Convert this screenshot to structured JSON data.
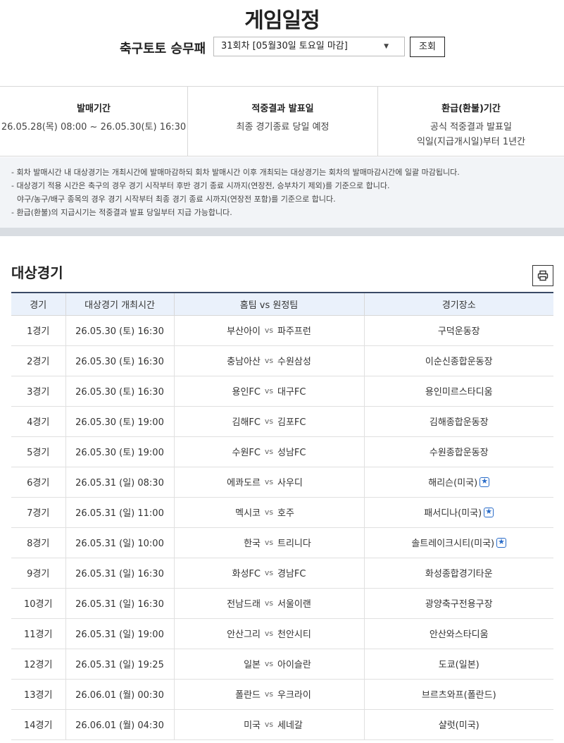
{
  "page_title": "게임일정",
  "filter": {
    "label": "축구토토 승무패",
    "selected_round": "31회차 [05월30일 토요일 마감]",
    "search_button": "조회"
  },
  "info": {
    "sale_period": {
      "title": "발매기간",
      "value": "26.05.28(목) 08:00 ~ 26.05.30(토) 16:30"
    },
    "result_date": {
      "title": "적중결과 발표일",
      "value": "최종 경기종료 당일 예정"
    },
    "refund_period": {
      "title": "환급(환불)기간",
      "line1": "공식 적중결과 발표일",
      "line2": "익일(지급개시일)부터 1년간"
    }
  },
  "notes": [
    "- 회차 발매시간 내 대상경기는 개최시간에 발매마감하되 회차 발매시간 이후 개최되는 대상경기는 회차의 발매마감시간에 일괄 마감됩니다.",
    "- 대상경기 적용 시간은 축구의 경우 경기 시작부터 후반 경기 종료 시까지(연장전, 승부차기 제외)를 기준으로 합니다.",
    "야구/농구/배구 종목의 경우 경기 시작부터 최종 경기 종료 시까지(연장전 포함)를 기준으로 합니다.",
    "- 환급(환불)의 지급시기는 적중결과 발표 당일부터 지급 가능합니다."
  ],
  "section_title": "대상경기",
  "print_icon": "printer-icon",
  "table": {
    "headers": {
      "game": "경기",
      "time": "대상경기 개최시간",
      "teams": "홈팀 vs 원정팀",
      "venue": "경기장소"
    },
    "vs_label": "vs",
    "rows": [
      {
        "game": "1경기",
        "time": "26.05.30 (토) 16:30",
        "home": "부산아이",
        "away": "파주프런",
        "venue": "구덕운동장",
        "star": false
      },
      {
        "game": "2경기",
        "time": "26.05.30 (토) 16:30",
        "home": "충남아산",
        "away": "수원삼성",
        "venue": "이순신종합운동장",
        "star": false
      },
      {
        "game": "3경기",
        "time": "26.05.30 (토) 16:30",
        "home": "용인FC",
        "away": "대구FC",
        "venue": "용인미르스타디움",
        "star": false
      },
      {
        "game": "4경기",
        "time": "26.05.30 (토) 19:00",
        "home": "김해FC",
        "away": "김포FC",
        "venue": "김해종합운동장",
        "star": false
      },
      {
        "game": "5경기",
        "time": "26.05.30 (토) 19:00",
        "home": "수원FC",
        "away": "성남FC",
        "venue": "수원종합운동장",
        "star": false
      },
      {
        "game": "6경기",
        "time": "26.05.31 (일) 08:30",
        "home": "에콰도르",
        "away": "사우디",
        "venue": "해리슨(미국)",
        "star": true
      },
      {
        "game": "7경기",
        "time": "26.05.31 (일) 11:00",
        "home": "멕시코",
        "away": "호주",
        "venue": "패서디나(미국)",
        "star": true
      },
      {
        "game": "8경기",
        "time": "26.05.31 (일) 10:00",
        "home": "한국",
        "away": "트리니다",
        "venue": "솔트레이크시티(미국)",
        "star": true
      },
      {
        "game": "9경기",
        "time": "26.05.31 (일) 16:30",
        "home": "화성FC",
        "away": "경남FC",
        "venue": "화성종합경기타운",
        "star": false
      },
      {
        "game": "10경기",
        "time": "26.05.31 (일) 16:30",
        "home": "전남드래",
        "away": "서울이랜",
        "venue": "광양축구전용구장",
        "star": false
      },
      {
        "game": "11경기",
        "time": "26.05.31 (일) 19:00",
        "home": "안산그리",
        "away": "천안시티",
        "venue": "안산와스타디움",
        "star": false
      },
      {
        "game": "12경기",
        "time": "26.05.31 (일) 19:25",
        "home": "일본",
        "away": "아이슬란",
        "venue": "도쿄(일본)",
        "star": false
      },
      {
        "game": "13경기",
        "time": "26.06.01 (월) 00:30",
        "home": "폴란드",
        "away": "우크라이",
        "venue": "브르츠와프(폴란드)",
        "star": false
      },
      {
        "game": "14경기",
        "time": "26.06.01 (월) 04:30",
        "home": "미국",
        "away": "세네갈",
        "venue": "샬럿(미국)",
        "star": false
      }
    ]
  }
}
